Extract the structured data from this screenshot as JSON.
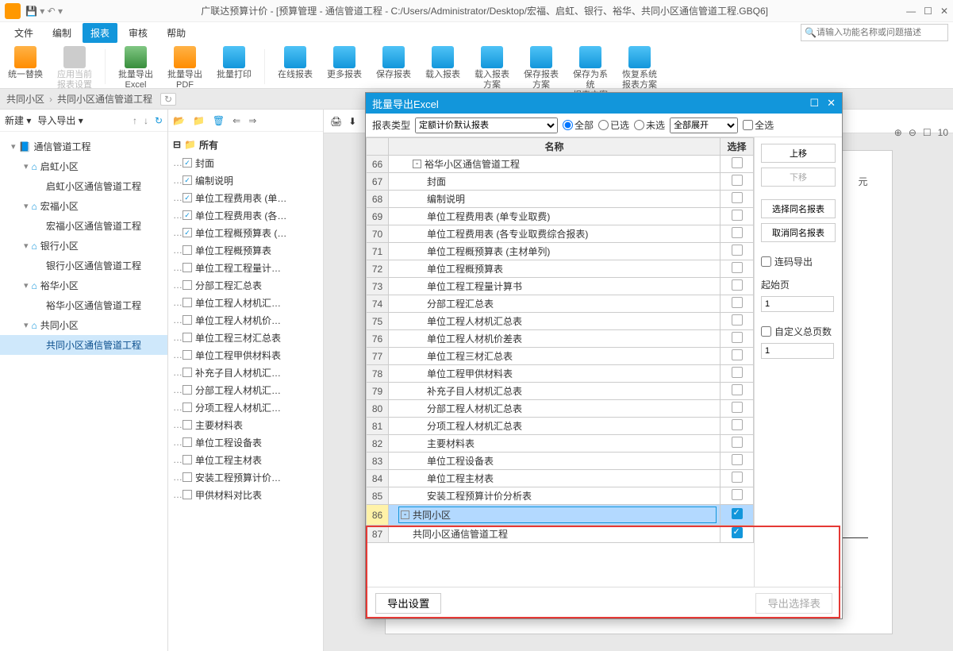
{
  "titlebar": {
    "title": "广联达预算计价 - [预算管理 - 通信管道工程 - C:/Users/Administrator/Desktop/宏福、启虹、银行、裕华、共同小区通信管道工程.GBQ6]"
  },
  "menubar": {
    "items": [
      "文件",
      "编制",
      "报表",
      "审核",
      "帮助"
    ],
    "active": 2,
    "search_placeholder": "请输入功能名称或问题描述"
  },
  "toolbar": {
    "btns": [
      {
        "label": "统一替换",
        "tone": "orange"
      },
      {
        "label": "应用当前\n报表设置",
        "tone": "gray",
        "disabled": true
      },
      {
        "label": "批量导出\nExcel",
        "tone": "green"
      },
      {
        "label": "批量导出\nPDF",
        "tone": "orange"
      },
      {
        "label": "批量打印",
        "tone": "blue"
      },
      {
        "label": "在线报表",
        "tone": "blue"
      },
      {
        "label": "更多报表",
        "tone": "blue"
      },
      {
        "label": "保存报表",
        "tone": "blue"
      },
      {
        "label": "载入报表",
        "tone": "blue"
      },
      {
        "label": "载入报表\n方案",
        "tone": "blue"
      },
      {
        "label": "保存报表\n方案",
        "tone": "blue"
      },
      {
        "label": "保存为系统\n报表方案",
        "tone": "blue"
      },
      {
        "label": "恢复系统\n报表方案",
        "tone": "blue"
      }
    ]
  },
  "breadcrumb": {
    "root": "共同小区",
    "leaf": "共同小区通信管道工程"
  },
  "left": {
    "new": "新建",
    "io": "导入导出",
    "tree": [
      {
        "lvl": 1,
        "exp": "▾",
        "icon": "📘",
        "label": "通信管道工程"
      },
      {
        "lvl": 2,
        "exp": "▾",
        "icon": "⌂",
        "label": "启虹小区"
      },
      {
        "lvl": 3,
        "label": "启虹小区通信管道工程"
      },
      {
        "lvl": 2,
        "exp": "▾",
        "icon": "⌂",
        "label": "宏福小区"
      },
      {
        "lvl": 3,
        "label": "宏福小区通信管道工程"
      },
      {
        "lvl": 2,
        "exp": "▾",
        "icon": "⌂",
        "label": "银行小区"
      },
      {
        "lvl": 3,
        "label": "银行小区通信管道工程"
      },
      {
        "lvl": 2,
        "exp": "▾",
        "icon": "⌂",
        "label": "裕华小区"
      },
      {
        "lvl": 3,
        "label": "裕华小区通信管道工程"
      },
      {
        "lvl": 2,
        "exp": "▾",
        "icon": "⌂",
        "label": "共同小区"
      },
      {
        "lvl": 3,
        "label": "共同小区通信管道工程",
        "selected": true
      }
    ]
  },
  "mid": {
    "header": "所有",
    "items": [
      {
        "checked": true,
        "label": "封面"
      },
      {
        "checked": true,
        "label": "编制说明"
      },
      {
        "checked": true,
        "label": "单位工程费用表 (单…"
      },
      {
        "checked": true,
        "label": "单位工程费用表 (各…"
      },
      {
        "checked": true,
        "label": "单位工程概预算表 (…"
      },
      {
        "checked": false,
        "label": "单位工程概预算表"
      },
      {
        "checked": false,
        "label": "单位工程工程量计…"
      },
      {
        "checked": false,
        "label": "分部工程汇总表"
      },
      {
        "checked": false,
        "label": "单位工程人材机汇…"
      },
      {
        "checked": false,
        "label": "单位工程人材机价…"
      },
      {
        "checked": false,
        "label": "单位工程三材汇总表"
      },
      {
        "checked": false,
        "label": "单位工程甲供材料表"
      },
      {
        "checked": false,
        "label": "补充子目人材机汇…"
      },
      {
        "checked": false,
        "label": "分部工程人材机汇…"
      },
      {
        "checked": false,
        "label": "分项工程人材机汇…"
      },
      {
        "checked": false,
        "label": "主要材料表"
      },
      {
        "checked": false,
        "label": "单位工程设备表"
      },
      {
        "checked": false,
        "label": "单位工程主材表"
      },
      {
        "checked": false,
        "label": "安装工程预算计价…"
      },
      {
        "checked": false,
        "label": "甲供材料对比表"
      }
    ]
  },
  "dialog": {
    "title": "批量导出Excel",
    "type_label": "报表类型",
    "type_value": "定额计价默认报表",
    "radio_all": "全部",
    "radio_sel": "已选",
    "radio_unsel": "未选",
    "expand": "全部展开",
    "allcheck": "全选",
    "col_name": "名称",
    "col_sel": "选择",
    "rows": [
      {
        "n": 66,
        "depth": 1,
        "exp": "-",
        "label": "裕华小区通信管道工程"
      },
      {
        "n": 67,
        "depth": 2,
        "label": "封面"
      },
      {
        "n": 68,
        "depth": 2,
        "label": "编制说明"
      },
      {
        "n": 69,
        "depth": 2,
        "label": "单位工程费用表 (单专业取费)"
      },
      {
        "n": 70,
        "depth": 2,
        "label": "单位工程费用表 (各专业取费综合报表)"
      },
      {
        "n": 71,
        "depth": 2,
        "label": "单位工程概预算表 (主材单列)"
      },
      {
        "n": 72,
        "depth": 2,
        "label": "单位工程概预算表"
      },
      {
        "n": 73,
        "depth": 2,
        "label": "单位工程工程量计算书"
      },
      {
        "n": 74,
        "depth": 2,
        "label": "分部工程汇总表"
      },
      {
        "n": 75,
        "depth": 2,
        "label": "单位工程人材机汇总表"
      },
      {
        "n": 76,
        "depth": 2,
        "label": "单位工程人材机价差表"
      },
      {
        "n": 77,
        "depth": 2,
        "label": "单位工程三材汇总表"
      },
      {
        "n": 78,
        "depth": 2,
        "label": "单位工程甲供材料表"
      },
      {
        "n": 79,
        "depth": 2,
        "label": "补充子目人材机汇总表"
      },
      {
        "n": 80,
        "depth": 2,
        "label": "分部工程人材机汇总表"
      },
      {
        "n": 81,
        "depth": 2,
        "label": "分项工程人材机汇总表"
      },
      {
        "n": 82,
        "depth": 2,
        "label": "主要材料表"
      },
      {
        "n": 83,
        "depth": 2,
        "label": "单位工程设备表"
      },
      {
        "n": 84,
        "depth": 2,
        "label": "单位工程主材表"
      },
      {
        "n": 85,
        "depth": 2,
        "label": "安装工程预算计价分析表"
      },
      {
        "n": 86,
        "depth": 0,
        "exp": "-",
        "label": "共同小区",
        "selected": true,
        "checked": true
      },
      {
        "n": 87,
        "depth": 1,
        "label": "共同小区通信管道工程",
        "checked": true
      }
    ],
    "btn_up": "上移",
    "btn_down": "下移",
    "btn_sel_same": "选择同名报表",
    "btn_unsel_same": "取消同名报表",
    "cb_chain": "连码导出",
    "lbl_start": "起始页",
    "val_start": "1",
    "cb_total": "自定义总页数",
    "val_total": "1",
    "btn_setting": "导出设置",
    "btn_export": "导出选择表"
  },
  "preview": {
    "yuan": "元",
    "zoom": "10"
  }
}
